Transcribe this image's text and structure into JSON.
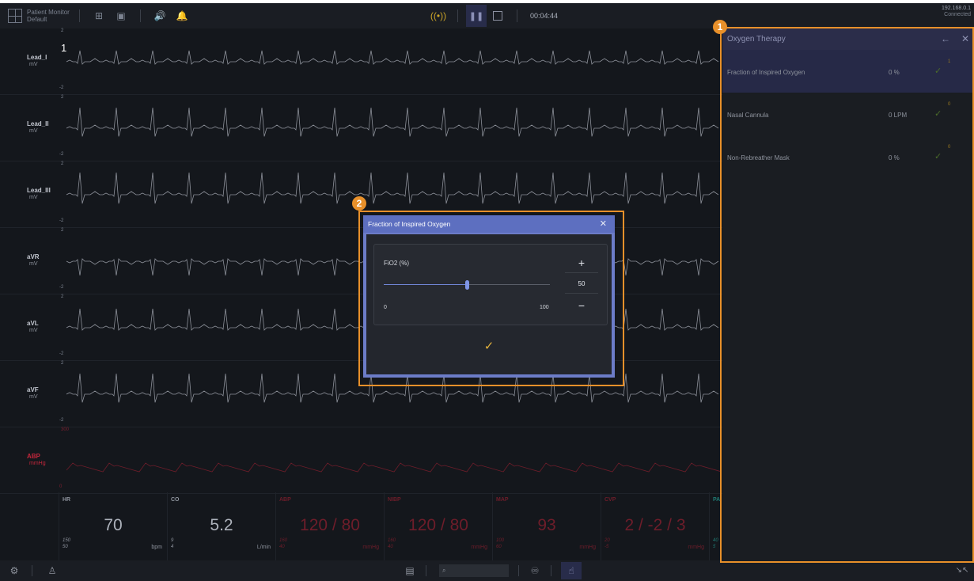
{
  "header": {
    "app_name": "Patient Monitor",
    "app_profile": "Default",
    "timer": "00:04:44",
    "ip": "192.168.0.1",
    "connection_status": "Connected"
  },
  "leads": [
    {
      "name": "Lead_I",
      "unit": "mV",
      "scale_max": "2",
      "scale_min": "-2"
    },
    {
      "name": "Lead_II",
      "unit": "mV",
      "scale_max": "2",
      "scale_min": "-2"
    },
    {
      "name": "Lead_III",
      "unit": "mV",
      "scale_max": "2",
      "scale_min": "-2"
    },
    {
      "name": "aVR",
      "unit": "mV",
      "scale_max": "2",
      "scale_min": "-2"
    },
    {
      "name": "aVL",
      "unit": "mV",
      "scale_max": "2",
      "scale_min": "-2"
    },
    {
      "name": "aVF",
      "unit": "mV",
      "scale_max": "2",
      "scale_min": "-2"
    },
    {
      "name": "ABP",
      "unit": "mmHg",
      "scale_max": "300",
      "scale_min": "0"
    }
  ],
  "lead_index_label": "1",
  "params": [
    {
      "label": "HR",
      "value": "70",
      "high": "150",
      "low": "50",
      "unit": "bpm"
    },
    {
      "label": "CO",
      "value": "5.2",
      "high": "9",
      "low": "4",
      "unit": "L/min"
    },
    {
      "label": "ABP",
      "value": "120 / 80",
      "high": "160",
      "low": "40",
      "unit": "mmHg"
    },
    {
      "label": "NIBP",
      "value": "120 / 80",
      "high": "160",
      "low": "40",
      "unit": "mmHg"
    },
    {
      "label": "MAP",
      "value": "93",
      "high": "100",
      "low": "60",
      "unit": "mmHg"
    },
    {
      "label": "CVP",
      "value": "2 / -2 / 3",
      "high": "20",
      "low": "-5",
      "unit": "mmHg"
    },
    {
      "label": "PA",
      "value": "",
      "high": "40",
      "low": "5",
      "unit": ""
    }
  ],
  "oxygen_panel": {
    "title": "Oxygen Therapy",
    "rows": [
      {
        "label": "Fraction of Inspired Oxygen",
        "value": "0 %",
        "count": "1",
        "selected": true
      },
      {
        "label": "Nasal Cannula",
        "value": "0 LPM",
        "count": "0",
        "selected": false
      },
      {
        "label": "Non-Rebreather Mask",
        "value": "0 %",
        "count": "0",
        "selected": false
      }
    ]
  },
  "modal": {
    "title": "Fraction of Inspired Oxygen",
    "field_label": "FiO2 (%)",
    "value": "50",
    "min": "0",
    "max": "100",
    "slider_fraction": 0.5
  },
  "callouts": {
    "one": "1",
    "two": "2"
  },
  "colors": {
    "accent_orange": "#e8902a",
    "modal_blue": "#6c7cc8",
    "alarm_red": "#c2263b",
    "confirm_gold": "#e3b23c"
  }
}
